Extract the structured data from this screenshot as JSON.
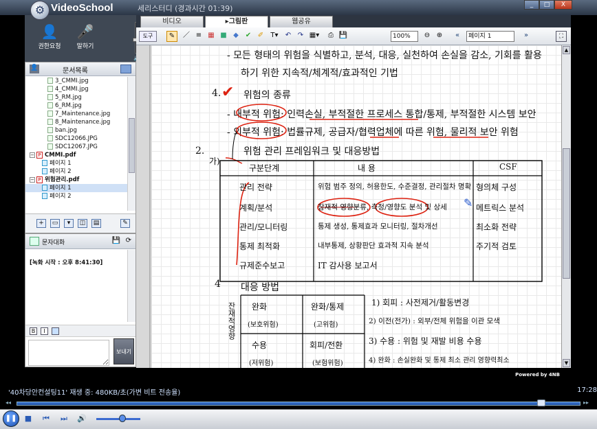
{
  "titlebar": {
    "app_name": "VideoSchool",
    "session_title": "세리스터디 (경과시간 01:39)",
    "min": "_",
    "max": "□",
    "close": "X"
  },
  "left": {
    "request_label": "권한요청",
    "hand_label": "말하기",
    "doc_tab": "문서목록",
    "tree": [
      {
        "label": "3_CMMI.jpg",
        "kind": "img"
      },
      {
        "label": "4_CMMI.jpg",
        "kind": "img"
      },
      {
        "label": "5_RM.jpg",
        "kind": "img"
      },
      {
        "label": "6_RM.jpg",
        "kind": "img"
      },
      {
        "label": "7_Maintenance.jpg",
        "kind": "img"
      },
      {
        "label": "8_Maintenance.jpg",
        "kind": "img"
      },
      {
        "label": "ban.jpg",
        "kind": "img"
      },
      {
        "label": "SDC12066.JPG",
        "kind": "img"
      },
      {
        "label": "SDC12067.JPG",
        "kind": "img"
      },
      {
        "label": "CMMI.pdf",
        "kind": "pdf"
      },
      {
        "label": "페이지 1",
        "kind": "page"
      },
      {
        "label": "페이지 2",
        "kind": "page"
      },
      {
        "label": "위험관리.pdf",
        "kind": "pdf"
      },
      {
        "label": "페이지 1",
        "kind": "page",
        "selected": true
      },
      {
        "label": "페이지 2",
        "kind": "page"
      }
    ],
    "chat_title": "문자대화",
    "chat_log": "[녹화 시작 : 오후 8:41:30]",
    "chat_input_placeholder": "",
    "send_label": "보내기",
    "format_bold": "B",
    "format_italic": "I"
  },
  "tabs": {
    "video": "비디오",
    "board": "그림판",
    "web": "웹공유",
    "active": "board"
  },
  "toolbar": {
    "tools_label": "도구",
    "zoom": "100%",
    "page": "페이지 1"
  },
  "board": {
    "lines": {
      "l1": "- 모든 형태의 위험을 식별하고, 분석, 대응, 실천하여 손실을 감소, 기회를 활용",
      "l2": "하기 위한 지속적/체계적/효과적인 기법",
      "l3_num": "4.",
      "l3": "위험의 종류",
      "l4": "- 내부적 위험: 인력손실, 부적절한 프로세스 통합/통제, 부적절한 시스템 보안",
      "l5": "- 외부적 위험: 법률규제, 공급자/협력업체에 따른 위험, 물리적 보안 위험",
      "l6_num": "2.",
      "l6": "위험 관리 프레임워크 및 대응방법",
      "l7_mark": "가)",
      "th_stage": "구분단계",
      "th_content": "내 용",
      "th_csf": "CSF",
      "r1c1": "관리 전략",
      "r1c2": "위험 범주 정의, 허용한도, 수준결정, 관리절차 명확",
      "r1c3": "형의체 구성",
      "r2c1": "계획/분석",
      "r2c2": "잠재적 영향분류, 측정/영향도 분석 및 상세",
      "r2c3": "메트릭스 분석",
      "r3c1": "관리/모니터링",
      "r3c2": "통제 생성, 통제효과 모니터링, 절차개선",
      "r3c3": "최소화 전략",
      "r4c1": "통제 최적화",
      "r4c2": "내부통제, 상황판단 효과적 지속 분석",
      "r4c3": "주기적 검토",
      "r5c1": "규제준수보고",
      "r5c2": "IT 감사용 보고서",
      "l8_num": "4",
      "l8": "대응 방법",
      "side_label": "잔재적영향",
      "b1": "완화",
      "b1s": "(보호위험)",
      "b2": "완화/통제",
      "b2s": "(고위험)",
      "b3": "수용",
      "b3s": "(저위험)",
      "b4": "회피/전환",
      "b4s": "(보험위험)",
      "n1": "1) 회피 : 사전제거/활동변경",
      "n2": "2) 이전(전가) : 외부/전체 위험을 이관 모색",
      "n3": "3) 수용 : 위험 및 재발 비용 수용",
      "n4": "4) 완화 : 손실완화 및 통제 최소 관리 영향력최소"
    },
    "powered": "Powered by 4NB"
  },
  "player": {
    "status": "'40차당안컨설팅11' 재생 중: 480KB/초(가변 비트 전송율)",
    "time": "17:28",
    "progress": 0.93,
    "volume": 0.6
  }
}
